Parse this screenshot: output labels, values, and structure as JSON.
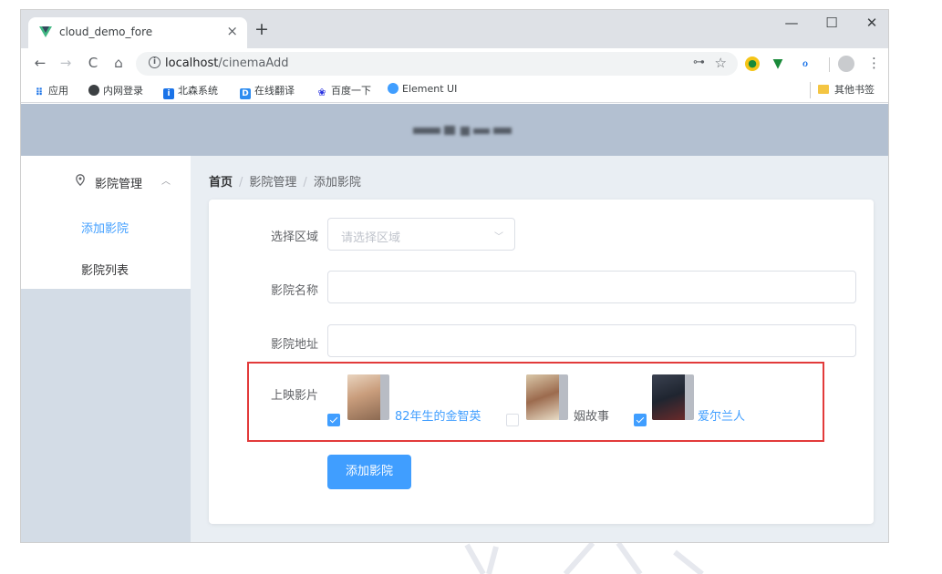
{
  "browser": {
    "tab_title": "cloud_demo_fore",
    "tab_close": "×",
    "new_tab": "+",
    "window_controls": {
      "minimize": "—",
      "maximize": "☐",
      "close": "✕"
    },
    "nav": {
      "back": "←",
      "forward": "→",
      "reload": "C",
      "home": "⌂"
    },
    "url_host": "localhost",
    "url_path": "/cinemaAdd",
    "bookmarks": [
      {
        "label": "应用",
        "icon": "apps-grid-icon",
        "color": "#1a73e8"
      },
      {
        "label": "内网登录",
        "icon": "globe-icon",
        "color": "#444444"
      },
      {
        "label": "北森系统",
        "icon": "beisen-icon",
        "color": "#1a73e8"
      },
      {
        "label": "在线翻译",
        "icon": "translate-icon",
        "color": "#2d8cf0"
      },
      {
        "label": "百度一下",
        "icon": "baidu-paw-icon",
        "color": "#2932e1"
      },
      {
        "label": "Element UI",
        "icon": "element-icon",
        "color": "#409eff"
      }
    ],
    "other_bookmarks": "其他书签"
  },
  "sidebar": {
    "group_label": "影院管理",
    "items": [
      {
        "label": "添加影院",
        "active": true
      },
      {
        "label": "影院列表",
        "active": false
      }
    ]
  },
  "breadcrumb": {
    "items": [
      "首页",
      "影院管理",
      "添加影院"
    ],
    "separator": "/"
  },
  "form": {
    "region_label": "选择区域",
    "region_placeholder": "请选择区域",
    "name_label": "影院名称",
    "name_value": "",
    "address_label": "影院地址",
    "address_value": "",
    "films_label": "上映影片",
    "films": [
      {
        "name": "82年生的金智英",
        "checked": true
      },
      {
        "name": "姻故事",
        "checked": false
      },
      {
        "name": "爱尔兰人",
        "checked": true
      }
    ],
    "submit_label": "添加影院"
  },
  "colors": {
    "primary": "#409eff",
    "header_bg": "#b3c0d1",
    "sidebar_bg": "#d3dce6",
    "main_bg": "#e9eef3",
    "highlight_border": "#e23b3b"
  }
}
